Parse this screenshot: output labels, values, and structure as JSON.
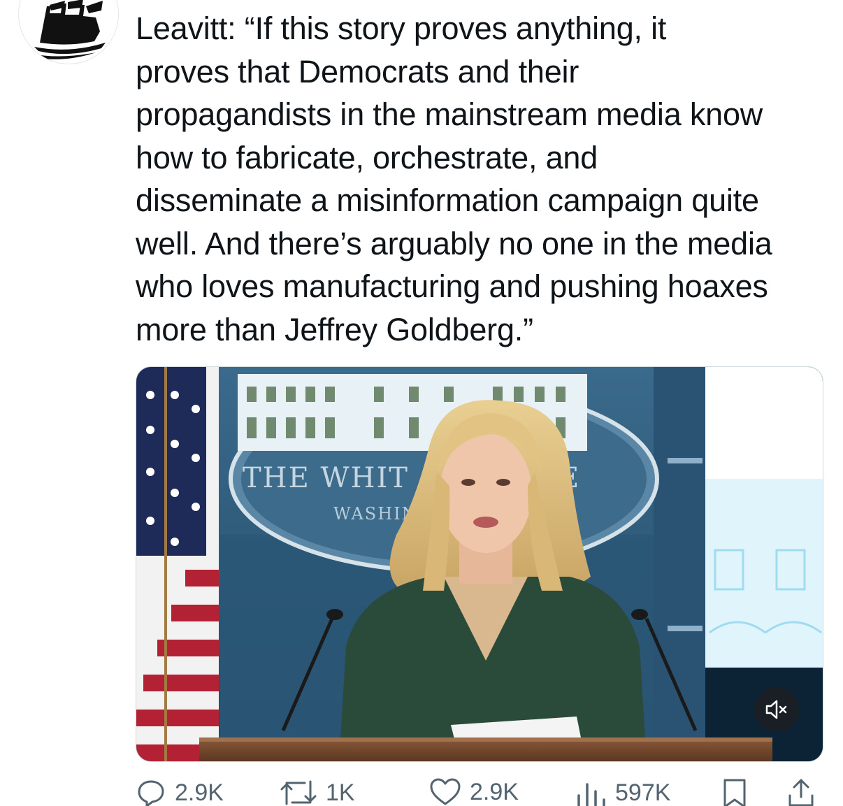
{
  "tweet": {
    "text": "Leavitt: “If this story proves anything, it\nproves that Democrats and their\npropagandists in the mainstream media know\nhow to fabricate,  orchestrate, and\ndisseminate a misinformation campaign quite\nwell. And there’s arguably no one in the media\nwho loves manufacturing and pushing hoaxes\nmore than Jeffrey Goldberg.”",
    "avatar_icon": "ship-icon"
  },
  "media": {
    "backdrop_title": "THE WHIT",
    "backdrop_title_tail": "E",
    "backdrop_subtitle": "WASHIN",
    "mute_icon": "speaker-muted-icon"
  },
  "actions": {
    "replies": "2.9K",
    "reposts": "1K",
    "likes": "2.9K",
    "views": "597K"
  },
  "colors": {
    "text": "#0f1419",
    "secondary": "#536471",
    "backdrop_blue": "#2f5878"
  }
}
